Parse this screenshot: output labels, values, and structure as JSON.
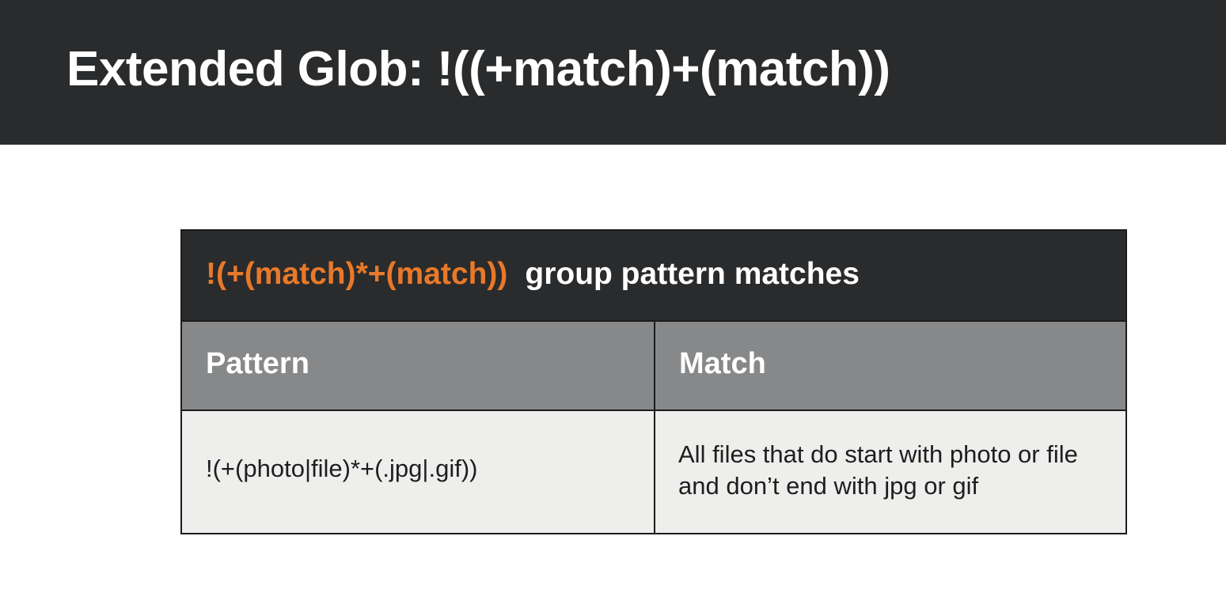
{
  "title": "Extended Glob: !((+match)+(match))",
  "table": {
    "caption_pattern": "!(+(match)*+(match))",
    "caption_label": "group pattern matches",
    "columns": [
      "Pattern",
      "Match"
    ],
    "rows": [
      {
        "pattern": "!(+(photo|file)*+(.jpg|.gif))",
        "match": "All files that do start with photo or file and don’t end with jpg or gif"
      }
    ]
  },
  "colors": {
    "header_background": "#2a2b2c",
    "accent": "#e8792a",
    "column_header_background": "#878889",
    "cell_background": "#eeeeed"
  }
}
